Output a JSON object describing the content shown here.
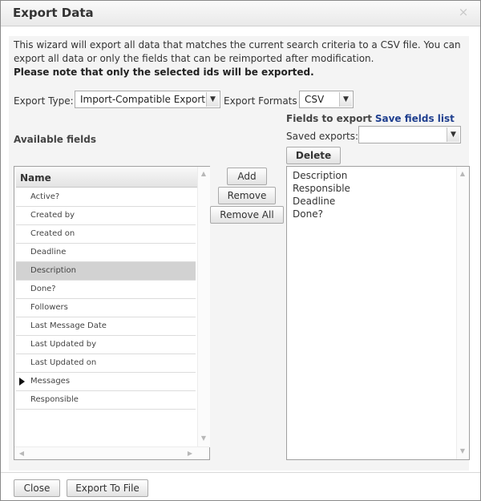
{
  "dialog": {
    "title": "Export Data",
    "close_symbol": "×"
  },
  "intro": {
    "text": "This wizard will export all data that matches the current search criteria to a CSV file. You can export all data or only the fields that can be reimported after modification.",
    "note": "Please note that only the selected ids will be exported."
  },
  "export_type": {
    "label": "Export Type:",
    "value": "Import-Compatible Export"
  },
  "export_formats": {
    "label": "Export Formats",
    "value": "CSV"
  },
  "available": {
    "title": "Available fields",
    "column_header": "Name",
    "fields": [
      "Active?",
      "Created by",
      "Created on",
      "Deadline",
      "Description",
      "Done?",
      "Followers",
      "Last Message Date",
      "Last Updated by",
      "Last Updated on",
      "Messages",
      "Responsible"
    ],
    "selected_index": 4,
    "expandable_index": 10
  },
  "actions": {
    "add": "Add",
    "remove": "Remove",
    "remove_all": "Remove All"
  },
  "to_export": {
    "title": "Fields to export",
    "save_link": "Save fields list",
    "saved_label": "Saved exports:",
    "saved_value": "",
    "delete": "Delete",
    "fields": [
      "Description",
      "Responsible",
      "Deadline",
      "Done?"
    ]
  },
  "footer": {
    "close": "Close",
    "export": "Export To File"
  },
  "icons": {
    "dropdown": "▼",
    "scroll_up": "▲",
    "scroll_down": "▼",
    "scroll_left": "◀",
    "scroll_right": "▶"
  }
}
